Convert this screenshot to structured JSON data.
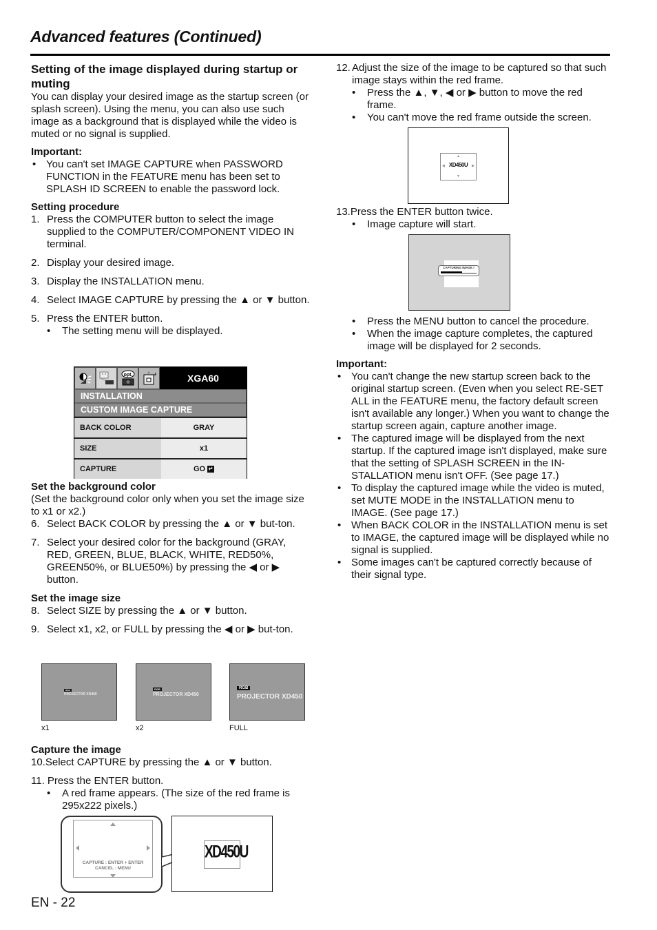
{
  "header": {
    "title": "Advanced features (Continued)"
  },
  "left": {
    "section_title": "Setting of the image displayed during startup or muting",
    "intro": "You can display your desired image as the startup screen (or splash screen). Using the menu, you can also use such image as a background that is displayed while the video is muted or no signal is supplied.",
    "important_heading": "Important:",
    "important_items": [
      "You can't set IMAGE CAPTURE when PASSWORD FUNCTION in the FEATURE menu has been set to SPLASH ID SCREEN to enable the password lock."
    ],
    "procedure_heading": "Setting procedure",
    "steps_a": [
      {
        "num": "1.",
        "text": "Press the COMPUTER button to select the image supplied to the COMPUTER/COMPONENT VIDEO IN terminal."
      },
      {
        "num": "2.",
        "text": "Display your desired image."
      },
      {
        "num": "3.",
        "text": "Display the INSTALLATION menu."
      },
      {
        "num": "4.",
        "text": "Select IMAGE CAPTURE by pressing the ▲ or ▼ button."
      },
      {
        "num": "5.",
        "text": "Press the ENTER button."
      }
    ],
    "step5_sub": "The setting menu will be displayed.",
    "bg_heading": "Set the background color",
    "bg_note": "(Set the background color only when you set the image size to x1 or x2.)",
    "steps_b": [
      {
        "num": "6.",
        "text": "Select BACK COLOR by pressing the ▲ or ▼ but-ton."
      },
      {
        "num": "7.",
        "text": "Select your desired color for the background (GRAY, RED, GREEN, BLUE, BLACK, WHITE, RED50%, GREEN50%, or  BLUE50%) by pressing the ◀ or ▶ button."
      }
    ],
    "size_heading": "Set the image size",
    "steps_c": [
      {
        "num": "8.",
        "text": "Select SIZE by pressing the ▲ or ▼ button."
      },
      {
        "num": "9.",
        "text": "Select x1, x2, or FULL by pressing the ◀ or ▶ but-ton."
      }
    ],
    "thumbnails": [
      {
        "caption": "x1",
        "logo": "RGB",
        "text": "PROJECTOR XD450"
      },
      {
        "caption": "x2",
        "logo": "RGB",
        "text": "PROJECTOR XD450"
      },
      {
        "caption": "FULL",
        "logo": "RGB",
        "text": "PROJECTOR XD450"
      }
    ],
    "capture_heading": "Capture the image",
    "step10": {
      "num": "10.",
      "text": "Select CAPTURE by pressing the ▲ or ▼ button."
    },
    "step11": {
      "num": "11.",
      "text": "Press the ENTER button."
    },
    "step11_sub": "A red frame appears.  (The size of the red frame is 295x222 pixels.)",
    "callout": {
      "line1": "CAPTURE : ENTER + ENTER",
      "line2": "CANCEL : MENU"
    },
    "big_screen_text": "XD450U"
  },
  "osd_menu": {
    "tabs": [
      "picture-tab",
      "installation-tab",
      "opt",
      "feature-tab"
    ],
    "opt_label": "opt.",
    "signal": "XGA60",
    "menu": "INSTALLATION",
    "submenu": "CUSTOM IMAGE CAPTURE",
    "rows": [
      {
        "label": "BACK COLOR",
        "value": "GRAY"
      },
      {
        "label": "SIZE",
        "value": "x1"
      },
      {
        "label": "CAPTURE",
        "value": "GO"
      }
    ],
    "enter_icon": "↵"
  },
  "right": {
    "step12": {
      "num": "12.",
      "text": "Adjust the size of the image to be captured so that such image stays within the red frame."
    },
    "step12_subs": [
      "Press the ▲, ▼, ◀ or ▶ button to move the red frame.",
      "You can't move the red frame outside the screen."
    ],
    "screen1_text": "XD450U",
    "step13": {
      "num": "13.",
      "text": "Press the ENTER button twice."
    },
    "step13_sub": "Image capture will start.",
    "capturing_label": "CAPTURING IMAGE !",
    "capture_progress": 0.6,
    "after_subs": [
      "Press the MENU button to cancel the procedure.",
      "When the image capture completes, the captured image will be displayed for 2 seconds."
    ],
    "important_heading": "Important:",
    "important_items": [
      "You can't change the new startup screen back to the original startup screen.  (Even when you select RE-SET ALL in the FEATURE menu, the factory default screen isn't available any longer.)  When you want to change the startup screen again, capture another image.",
      "The captured image will be displayed from the next startup.  If the captured image isn't displayed, make sure that the setting of SPLASH SCREEN in the IN-STALLATION menu isn't OFF.  (See page 17.)",
      "To display the captured image while the video is muted, set MUTE MODE in the INSTALLATION menu to IMAGE.  (See page 17.)",
      "When BACK COLOR in the INSTALLATION menu is set to IMAGE, the captured image will be displayed while no signal is supplied.",
      "Some images can't be captured correctly because of their signal type."
    ]
  },
  "footer": {
    "page": "EN - 22"
  },
  "bullet": "•"
}
